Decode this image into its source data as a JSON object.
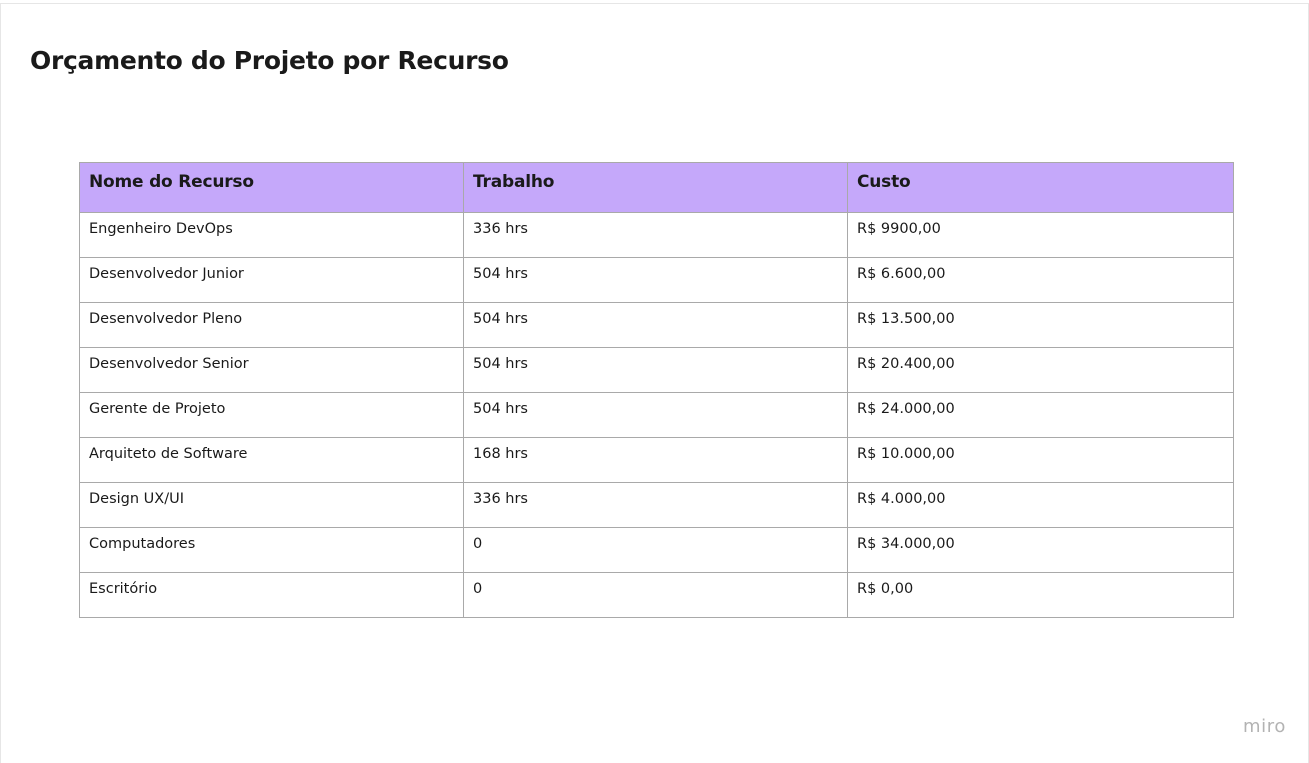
{
  "title": "Orçamento do Projeto por Recurso",
  "table": {
    "headers": [
      "Nome do Recurso",
      "Trabalho",
      "Custo"
    ],
    "rows": [
      [
        "Engenheiro DevOps",
        "336 hrs",
        "R$ 9900,00"
      ],
      [
        "Desenvolvedor Junior",
        "504 hrs",
        "R$ 6.600,00"
      ],
      [
        "Desenvolvedor Pleno",
        "504 hrs",
        "R$ 13.500,00"
      ],
      [
        "Desenvolvedor Senior",
        "504 hrs",
        "R$ 20.400,00"
      ],
      [
        "Gerente de Projeto",
        "504 hrs",
        "R$ 24.000,00"
      ],
      [
        "Arquiteto de Software",
        "168 hrs",
        "R$ 10.000,00"
      ],
      [
        "Design UX/UI",
        "336 hrs",
        "R$ 4.000,00"
      ],
      [
        "Computadores",
        "0",
        "R$ 34.000,00"
      ],
      [
        "Escritório",
        "0",
        "R$ 0,00"
      ]
    ]
  },
  "logo_text": "miro",
  "colors": {
    "header_background": "#c5a8fa",
    "border": "#a9a9a9",
    "text": "#1a1a1a",
    "logo": "#b3b3b3"
  }
}
